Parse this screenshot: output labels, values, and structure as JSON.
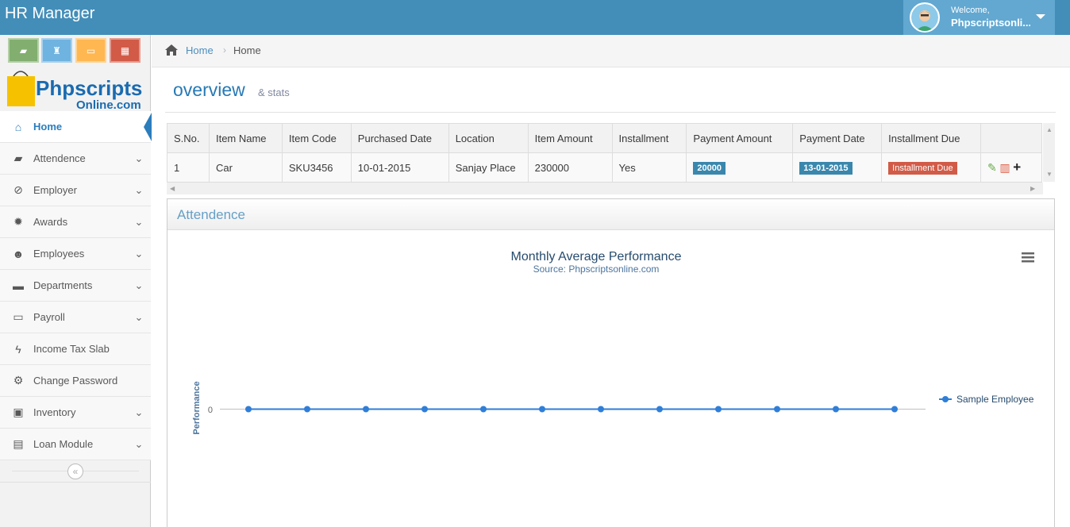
{
  "app": {
    "title": "HR Manager"
  },
  "user": {
    "welcome": "Welcome,",
    "name": "Phpscriptsonli..."
  },
  "shortcuts": [
    {
      "icon": "book-icon",
      "color": "#82af6f"
    },
    {
      "icon": "trophy-icon",
      "color": "#6fb3e0"
    },
    {
      "icon": "credit-card-icon",
      "color": "#ffb752"
    },
    {
      "icon": "calendar-icon",
      "color": "#d15b47"
    }
  ],
  "logo": {
    "line1": "Phpscripts",
    "line2": "Online.com"
  },
  "sidebar": {
    "items": [
      {
        "label": "Home",
        "icon": "home-icon",
        "glyph": "⌂",
        "active": true,
        "caret": false
      },
      {
        "label": "Attendence",
        "icon": "book-icon",
        "glyph": "▰",
        "active": false,
        "caret": true
      },
      {
        "label": "Employer",
        "icon": "ban-icon",
        "glyph": "⊘",
        "active": false,
        "caret": true
      },
      {
        "label": "Awards",
        "icon": "certificate-icon",
        "glyph": "✹",
        "active": false,
        "caret": true
      },
      {
        "label": "Employees",
        "icon": "users-icon",
        "glyph": "☻",
        "active": false,
        "caret": true
      },
      {
        "label": "Departments",
        "icon": "briefcase-icon",
        "glyph": "▬",
        "active": false,
        "caret": true
      },
      {
        "label": "Payroll",
        "icon": "credit-card-icon",
        "glyph": "▭",
        "active": false,
        "caret": true
      },
      {
        "label": "Income Tax Slab",
        "icon": "bolt-icon",
        "glyph": "ϟ",
        "active": false,
        "caret": false
      },
      {
        "label": "Change Password",
        "icon": "cogs-icon",
        "glyph": "⚙",
        "active": false,
        "caret": false
      },
      {
        "label": "Inventory",
        "icon": "gift-icon",
        "glyph": "▣",
        "active": false,
        "caret": true
      },
      {
        "label": "Loan Module",
        "icon": "money-icon",
        "glyph": "▤",
        "active": false,
        "caret": true
      }
    ]
  },
  "breadcrumb": {
    "home": "Home",
    "current": "Home"
  },
  "page": {
    "title": "overview",
    "subtitle": "& stats"
  },
  "table": {
    "headers": [
      "S.No.",
      "Item Name",
      "Item Code",
      "Purchased Date",
      "Location",
      "Item Amount",
      "Installment",
      "Payment Amount",
      "Payment Date",
      "Installment Due",
      ""
    ],
    "rows": [
      {
        "sno": "1",
        "item_name": "Car",
        "item_code": "SKU3456",
        "purchased_date": "10-01-2015",
        "location": "Sanjay Place",
        "item_amount": "230000",
        "installment": "Yes",
        "payment_amount": "20000",
        "payment_date": "13-01-2015",
        "installment_due": "Installment Due"
      }
    ]
  },
  "widget": {
    "title": "Attendence"
  },
  "chart_data": {
    "type": "line",
    "title": "Monthly Average Performance",
    "subtitle": "Source: Phpscriptsonline.com",
    "ylabel": "Performance",
    "xlabel": "",
    "yticks": [
      "0"
    ],
    "series": [
      {
        "name": "Sample Employee",
        "values": [
          0,
          0,
          0,
          0,
          0,
          0,
          0,
          0,
          0,
          0,
          0,
          0
        ]
      }
    ],
    "legend": "right",
    "colors": [
      "#2f7ed8"
    ]
  }
}
